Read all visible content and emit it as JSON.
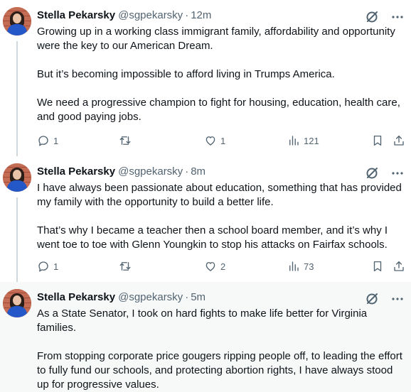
{
  "tweets": [
    {
      "author": {
        "name": "Stella Pekarsky",
        "handle": "@sgpekarsky"
      },
      "separator": "·",
      "time": "12m",
      "paragraphs": [
        "Growing up in a working class immigrant family, affordability and opportunity were the key to our American Dream.",
        "But it’s becoming impossible to afford living in Trumps America.",
        "We need a progressive champion to fight for housing, education, health care, and good paying jobs."
      ],
      "stats": {
        "replies": "1",
        "retweets": "",
        "likes": "1",
        "views": "121"
      }
    },
    {
      "author": {
        "name": "Stella Pekarsky",
        "handle": "@sgpekarsky"
      },
      "separator": "·",
      "time": "8m",
      "paragraphs": [
        "I have always been passionate about education, something that has provided my family with the opportunity to build a better life.",
        "That’s why I became a teacher then a school board member, and it’s why I went toe to toe with Glenn Youngkin to stop his attacks on Fairfax schools."
      ],
      "stats": {
        "replies": "1",
        "retweets": "",
        "likes": "2",
        "views": "73"
      }
    },
    {
      "author": {
        "name": "Stella Pekarsky",
        "handle": "@sgpekarsky"
      },
      "separator": "·",
      "time": "5m",
      "paragraphs": [
        "As a State Senator, I took on hard fights to make life better for Virginia families.",
        "From stopping corporate price gougers ripping people off, to leading the effort to fully fund our schools, and protecting abortion rights, I have always stood up for progressive values."
      ]
    }
  ],
  "icons": {
    "grok": "grok-icon",
    "more": "more-icon",
    "reply": "reply-icon",
    "retweet": "retweet-icon",
    "like": "heart-icon",
    "views": "views-icon",
    "bookmark": "bookmark-icon",
    "share": "share-icon"
  },
  "colors": {
    "text": "#0f1419",
    "secondary": "#536471",
    "thread_line": "#cfd9de",
    "highlight_bg": "#f7f9f9"
  }
}
